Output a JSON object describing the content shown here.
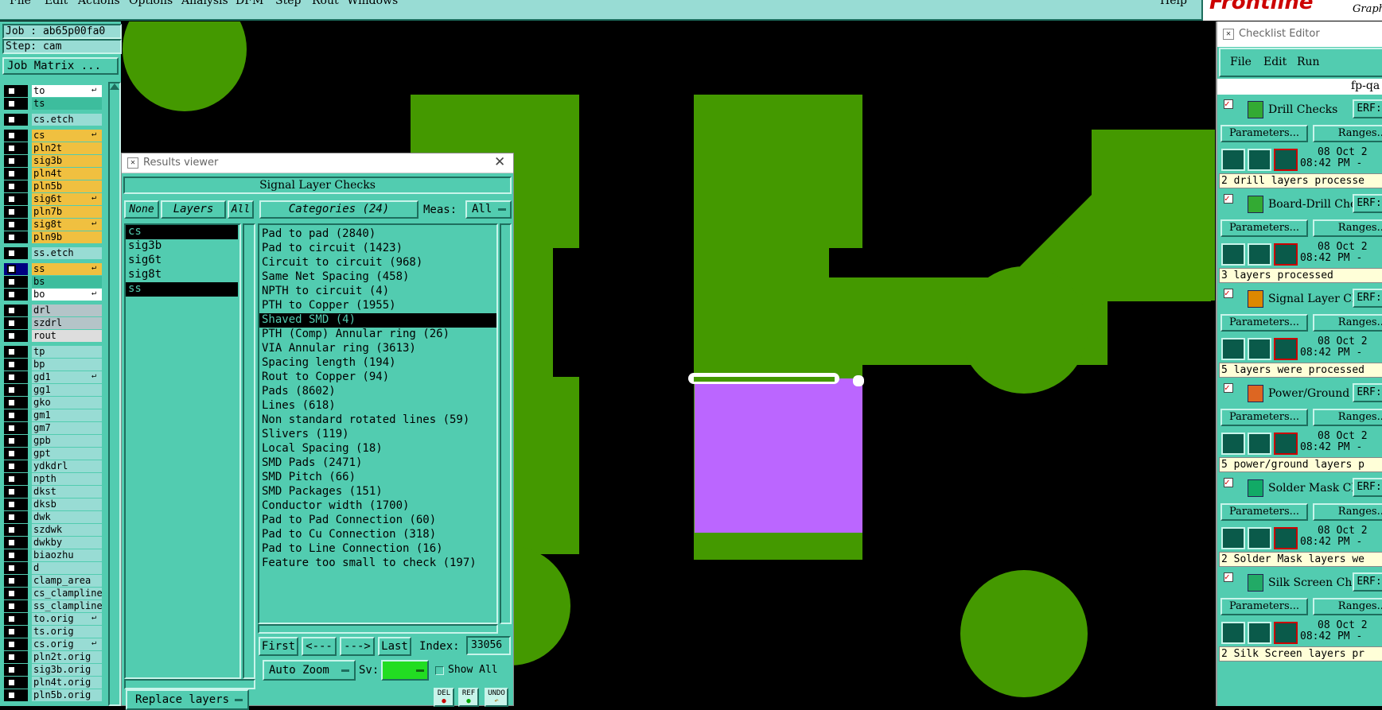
{
  "menubar": {
    "items": [
      "File",
      "Edit",
      "Actions",
      "Options",
      "Analysis",
      "DFM",
      "Step",
      "Rout",
      "Windows"
    ],
    "help": "Help",
    "brand": "Frontline",
    "brand_sub": "Graph"
  },
  "job": {
    "job_label": "Job : ab65p00fa0",
    "step_label": "Step: cam",
    "matrix_button": "Job Matrix ..."
  },
  "layers": [
    {
      "name": "to",
      "color": "#ffffff",
      "flag": "↵"
    },
    {
      "name": "ts",
      "color": "#3dbd9d",
      "flag": ""
    },
    {
      "name": "cs.etch",
      "color": "#98dcd4",
      "flag": ""
    },
    {
      "name": "cs",
      "color": "#f0c040",
      "flag": "↵"
    },
    {
      "name": "pln2t",
      "color": "#f0c040",
      "flag": ""
    },
    {
      "name": "sig3b",
      "color": "#f0c040",
      "flag": ""
    },
    {
      "name": "pln4t",
      "color": "#f0c040",
      "flag": ""
    },
    {
      "name": "pln5b",
      "color": "#f0c040",
      "flag": ""
    },
    {
      "name": "sig6t",
      "color": "#f0c040",
      "flag": "↵"
    },
    {
      "name": "pln7b",
      "color": "#f0c040",
      "flag": ""
    },
    {
      "name": "sig8t",
      "color": "#f0c040",
      "flag": "↵"
    },
    {
      "name": "pln9b",
      "color": "#f0c040",
      "flag": ""
    },
    {
      "name": "ss.etch",
      "color": "#98dcd4",
      "flag": ""
    },
    {
      "name": "ss",
      "color": "#f0c040",
      "flag": "↵"
    },
    {
      "name": "bs",
      "color": "#3dbd9d",
      "flag": ""
    },
    {
      "name": "bo",
      "color": "#ffffff",
      "flag": "↵"
    },
    {
      "name": "drl",
      "color": "#b4c4c8",
      "flag": ""
    },
    {
      "name": "szdrl",
      "color": "#b4c4c8",
      "flag": ""
    },
    {
      "name": "rout",
      "color": "#dddddd",
      "flag": ""
    },
    {
      "name": "tp",
      "color": "#98dcd4",
      "flag": ""
    },
    {
      "name": "bp",
      "color": "#98dcd4",
      "flag": ""
    },
    {
      "name": "gd1",
      "color": "#98dcd4",
      "flag": "↵"
    },
    {
      "name": "gg1",
      "color": "#98dcd4",
      "flag": ""
    },
    {
      "name": "gko",
      "color": "#98dcd4",
      "flag": ""
    },
    {
      "name": "gm1",
      "color": "#98dcd4",
      "flag": ""
    },
    {
      "name": "gm7",
      "color": "#98dcd4",
      "flag": ""
    },
    {
      "name": "gpb",
      "color": "#98dcd4",
      "flag": ""
    },
    {
      "name": "gpt",
      "color": "#98dcd4",
      "flag": ""
    },
    {
      "name": "ydkdrl",
      "color": "#98dcd4",
      "flag": ""
    },
    {
      "name": "npth",
      "color": "#98dcd4",
      "flag": ""
    },
    {
      "name": "dkst",
      "color": "#98dcd4",
      "flag": ""
    },
    {
      "name": "dksb",
      "color": "#98dcd4",
      "flag": ""
    },
    {
      "name": "dwk",
      "color": "#98dcd4",
      "flag": ""
    },
    {
      "name": "szdwk",
      "color": "#98dcd4",
      "flag": ""
    },
    {
      "name": "dwkby",
      "color": "#98dcd4",
      "flag": ""
    },
    {
      "name": "biaozhu",
      "color": "#98dcd4",
      "flag": ""
    },
    {
      "name": "d",
      "color": "#98dcd4",
      "flag": ""
    },
    {
      "name": "clamp_area",
      "color": "#98dcd4",
      "flag": ""
    },
    {
      "name": "cs_clampline",
      "color": "#98dcd4",
      "flag": ""
    },
    {
      "name": "ss_clampline",
      "color": "#98dcd4",
      "flag": ""
    },
    {
      "name": "to.orig",
      "color": "#98dcd4",
      "flag": "↵"
    },
    {
      "name": "ts.orig",
      "color": "#98dcd4",
      "flag": ""
    },
    {
      "name": "cs.orig",
      "color": "#98dcd4",
      "flag": "↵"
    },
    {
      "name": "pln2t.orig",
      "color": "#98dcd4",
      "flag": ""
    },
    {
      "name": "sig3b.orig",
      "color": "#98dcd4",
      "flag": ""
    },
    {
      "name": "pln4t.orig",
      "color": "#98dcd4",
      "flag": ""
    },
    {
      "name": "pln5b.orig",
      "color": "#98dcd4",
      "flag": ""
    }
  ],
  "results_viewer": {
    "title": "Results viewer",
    "header": "Signal Layer Checks",
    "none_btn": "None",
    "layers_btn": "Layers",
    "all_btn": "All",
    "categories_btn": "Categories (24)",
    "meas_label": "Meas:",
    "meas_value": "All",
    "layer_list": [
      "cs",
      "sig3b",
      "sig6t",
      "sig8t",
      "ss"
    ],
    "categories": [
      "Pad to pad (2840)",
      "Pad to circuit (1423)",
      "Circuit to circuit (968)",
      "Same Net Spacing (458)",
      "NPTH to circuit (4)",
      "PTH to Copper (1955)",
      "Shaved SMD (4)",
      "PTH (Comp) Annular ring (26)",
      "VIA Annular ring (3613)",
      "Spacing length (194)",
      "Rout to Copper (94)",
      "Pads (8602)",
      "Lines (618)",
      "Non standard rotated lines (59)",
      "Slivers (119)",
      "Local Spacing (18)",
      "SMD Pads (2471)",
      "SMD Pitch (66)",
      "SMD Packages (151)",
      "Conductor width (1700)",
      "Pad to Pad Connection (60)",
      "Pad to Cu Connection (318)",
      "Pad to Line Connection (16)",
      "Feature too small to check (197)"
    ],
    "first_btn": "First",
    "prev_btn": "<---",
    "next_btn": "--->",
    "last_btn": "Last",
    "index_label": "Index:",
    "index_value": "33056",
    "autozoom_btn": "Auto Zoom",
    "sv_label": "Sv:",
    "show_all_label": "Show All",
    "replace_btn": "Replace layers",
    "del_label": "DEL",
    "ref_label": "REF",
    "undo_label": "UNDO"
  },
  "checklist": {
    "title": "Checklist Editor",
    "menu": [
      "File",
      "Edit",
      "Run"
    ],
    "name": "fp-qa",
    "items": [
      {
        "name": "Drill Checks",
        "erf": "ERF:",
        "date1": "08 Oct 2",
        "date2": "08:42 PM - ",
        "status": "2 drill layers processe"
      },
      {
        "name": "Board-Drill Che",
        "erf": "ERF:",
        "date1": "08 Oct 2",
        "date2": "08:42 PM - ",
        "status": "3 layers processed"
      },
      {
        "name": "Signal Layer Ch",
        "erf": "ERF:",
        "date1": "08 Oct 2",
        "date2": "08:42 PM - ",
        "status": "5 layers were processed"
      },
      {
        "name": "Power/Ground C",
        "erf": "ERF:",
        "date1": "08 Oct 2",
        "date2": "08:42 PM - ",
        "status": "5 power/ground layers p"
      },
      {
        "name": "Solder Mask Che",
        "erf": "ERF:",
        "date1": "08 Oct 2",
        "date2": "08:42 PM - ",
        "status": "2 Solder Mask layers we"
      },
      {
        "name": "Silk Screen Che",
        "erf": "ERF:",
        "date1": "08 Oct 2",
        "date2": "08:42 PM - ",
        "status": "2 Silk Screen layers pr"
      }
    ],
    "params_btn": "Parameters...",
    "ranges_btn": "Ranges..."
  },
  "colors": {
    "copper": "#449900",
    "highlight": "#bb66ff",
    "panel": "#52ccb0"
  }
}
